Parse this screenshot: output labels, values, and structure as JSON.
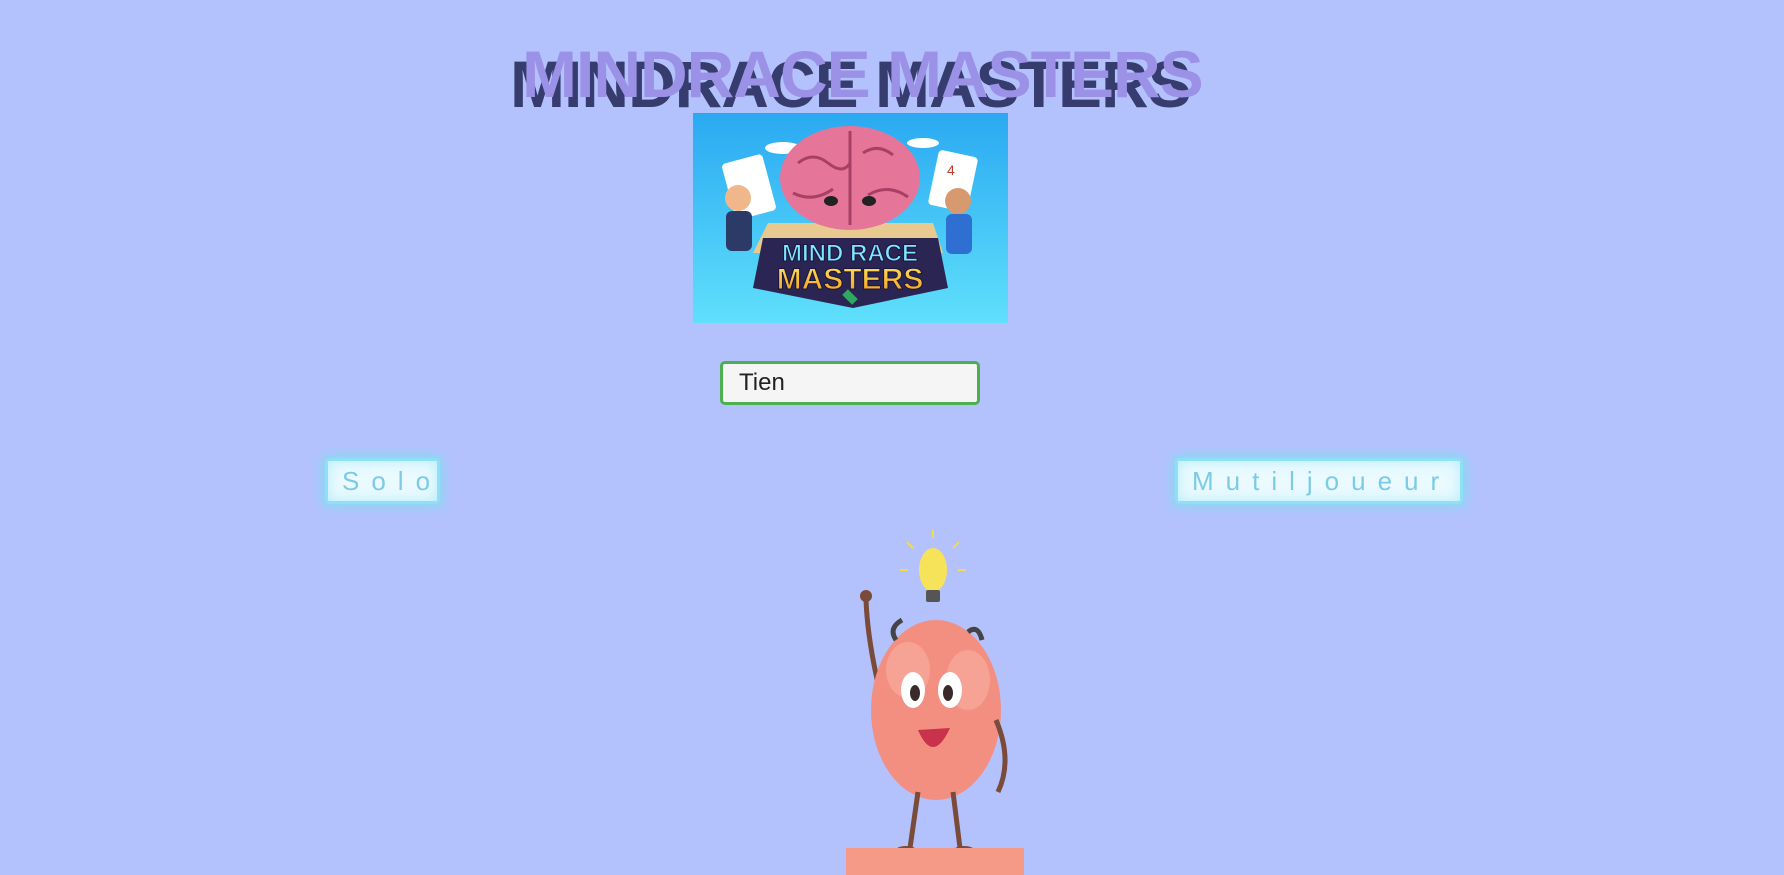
{
  "header": {
    "title": "MINDRACE MASTERS"
  },
  "logo": {
    "text_line1": "MIND RACE",
    "text_line2": "MASTERS"
  },
  "player": {
    "name_value": "Tien"
  },
  "modes": {
    "solo_label": "Solo",
    "multi_label": "Mutiljoueur"
  },
  "colors": {
    "background": "#b3c2fd",
    "title": "#9b91e6",
    "title_shadow": "#363d6e",
    "input_border": "#4caf50",
    "button_glow": "#87d9f2",
    "button_text": "#7ccbe6"
  },
  "icons": {
    "mascot": "brain-mascot-icon",
    "bulb": "lightbulb-icon"
  }
}
